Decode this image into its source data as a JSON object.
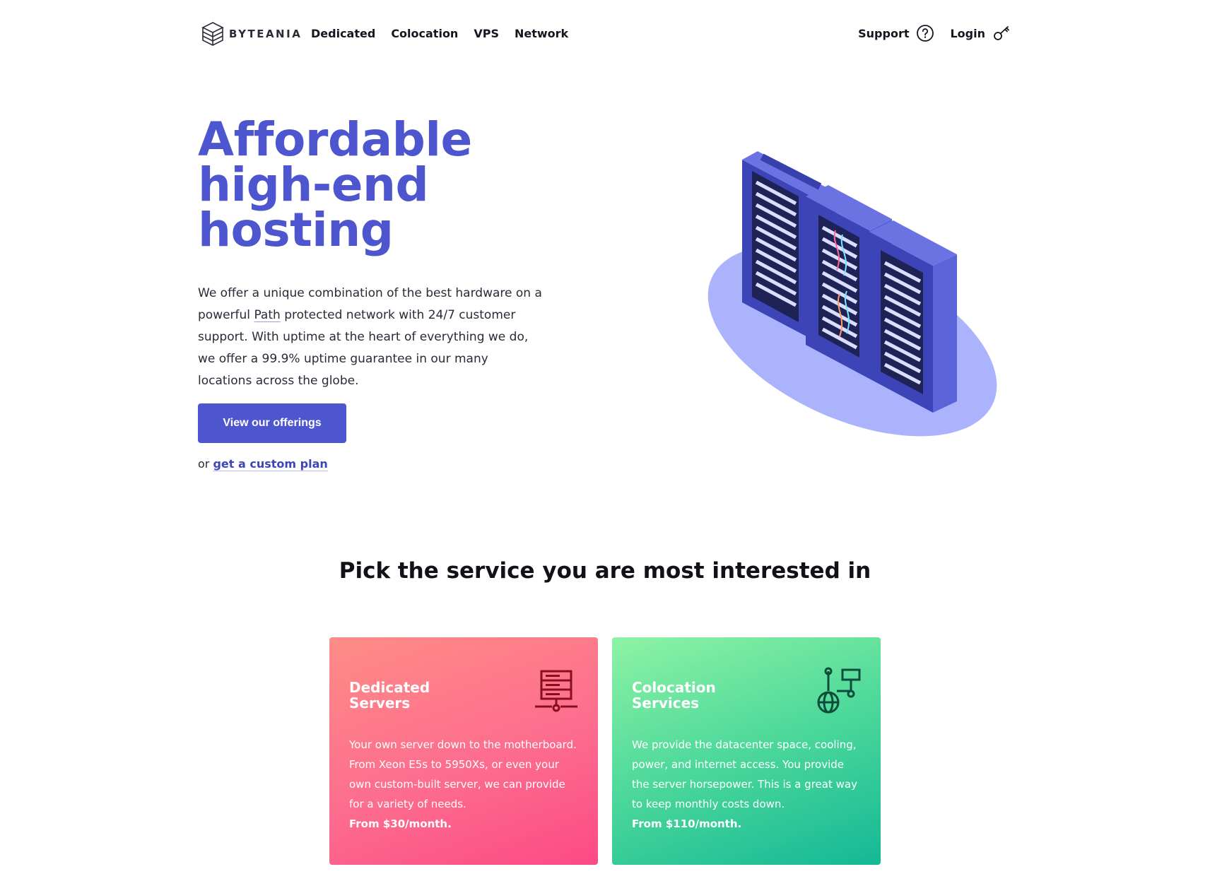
{
  "nav": {
    "logo_text": "BYTEANIA",
    "links": [
      "Dedicated",
      "Colocation",
      "VPS",
      "Network"
    ],
    "support_label": "Support",
    "login_label": "Login"
  },
  "hero": {
    "title_lines": [
      "Affordable",
      "high-end",
      "hosting"
    ],
    "text_before_path": "We offer a unique combination of the best hardware on a powerful ",
    "path_word": "Path",
    "text_after_path": " protected network with 24/7 customer support. With uptime at the heart of everything we do, we offer a 99.9% uptime guarantee in our many locations across the globe.",
    "cta_label": "View our offerings",
    "custom_prefix": "or",
    "custom_link": "get a custom plan"
  },
  "services": {
    "heading": "Pick the service you are most interested in",
    "cards": [
      {
        "title_lines": [
          "Dedicated",
          "Servers"
        ],
        "icon": "server-rack-icon",
        "description": "Your own server down to the motherboard. From Xeon E5s to 5950Xs, or even your own custom-built server, we can provide for a variety of needs.",
        "price": "From $30/month."
      },
      {
        "title_lines": [
          "Colocation",
          "Services"
        ],
        "icon": "globe-network-icon",
        "description": "We provide the datacenter space, cooling, power, and internet access. You provide the server horsepower. This is a great way to keep monthly costs down.",
        "price": "From $110/month."
      }
    ]
  },
  "colors": {
    "brand": "#4e56cf",
    "dedicated_gradient": [
      "#fe8c86",
      "#fc4a86"
    ],
    "colo_gradient": [
      "#8ef3a5",
      "#14b896"
    ]
  }
}
